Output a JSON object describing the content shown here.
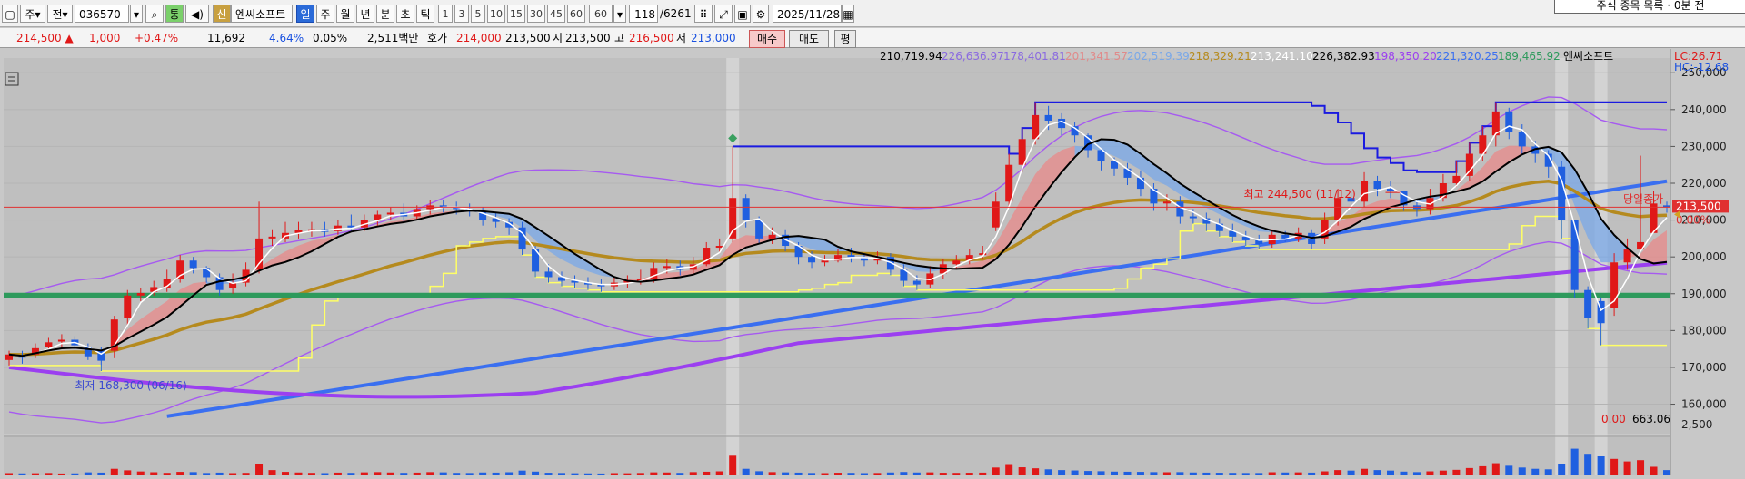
{
  "toolbar": {
    "period": "주",
    "period_alt": "전",
    "code": "036570",
    "name": "엔씨소프트",
    "badge_new": "신",
    "badge_tong": "통",
    "tf_day": "일",
    "tf_week": "주",
    "tf_month": "월",
    "tf_year": "년",
    "tf_minute": "분",
    "tf_tick_sec": "초",
    "tf_tick": "틱",
    "n1": "1",
    "n3": "3",
    "n5": "5",
    "n10": "10",
    "n15": "15",
    "n30": "30",
    "n45": "45",
    "n60": "60",
    "n60b": "60",
    "count": "118",
    "total": "/6261",
    "date": "2025/11/28",
    "top_right_text": "주식 종목 목록 · 0분 전"
  },
  "quote": {
    "price": "214,500",
    "change": "1,000",
    "change_pct": "+0.47%",
    "volume": "11,692",
    "turnover_pct": "4.64%",
    "ratio": "0.05%",
    "amount": "2,511백만",
    "ask_label": "호가",
    "ask": "214,000",
    "bid": "213,500",
    "open_label": "시",
    "open": "213,500",
    "high_label": "고",
    "high": "216,500",
    "low_label": "저",
    "low": "213,000",
    "buy": "매수",
    "sell": "매도",
    "avg": "평"
  },
  "colors": {
    "up": "#e01818",
    "down": "#1f5fe0",
    "ma5": "#ffffff",
    "ma20": "#000000",
    "ma60": "#b58a1e",
    "ma120": "#3a6ff0",
    "ma240": "#9b3ff0",
    "envelope": "#a65af0",
    "support": "#2e9a5c",
    "donchian": "#1a1ae0",
    "trail": "#ffff66",
    "current": "#e03030"
  },
  "chart_data": {
    "type": "candlestick",
    "legend": {
      "items": [
        {
          "value": "210,719.94",
          "color": "#000000"
        },
        {
          "value": "226,636.97",
          "color": "#8a6ae0"
        },
        {
          "value": "178,401.81",
          "color": "#8a6ae0"
        },
        {
          "value": "201,341.57",
          "color": "#e08a8a"
        },
        {
          "value": "202,519.39",
          "color": "#7aa8e8"
        },
        {
          "value": "218,329.21",
          "color": "#b58a1e"
        },
        {
          "value": "213,241.10",
          "color": "#ffffff"
        },
        {
          "value": "226,382.93",
          "color": "#000000"
        },
        {
          "value": "198,350.20",
          "color": "#9b3ff0"
        },
        {
          "value": "221,320.25",
          "color": "#3a6ff0"
        },
        {
          "value": "189,465.92",
          "color": "#2e9a5c"
        }
      ],
      "name": "엔씨소프트",
      "lc": "LC:26.71",
      "hc": "HC:-12.68"
    },
    "y_axis": {
      "min": 152000,
      "max": 254000,
      "ticks": [
        "250,000",
        "240,000",
        "230,000",
        "220,000",
        "210,000",
        "200,000",
        "190,000",
        "180,000",
        "170,000",
        "160,000"
      ],
      "tick_values": [
        250000,
        240000,
        230000,
        220000,
        210000,
        200000,
        190000,
        180000,
        170000,
        160000
      ]
    },
    "current_price": {
      "value": 213500,
      "label": "213,500",
      "pct": "0.00%",
      "caption": "당일종가"
    },
    "support_level": 189500,
    "annotations": {
      "high": {
        "label": "최고 244,500 (11/12)",
        "index": 106
      },
      "low": {
        "label": "최저 168,300 (06/16)",
        "index": 1
      }
    },
    "volume_panel": {
      "legend_value": "0.00",
      "legend_total": "663.06",
      "tick": "2,500",
      "max": 3000
    },
    "closes": [
      173500,
      172800,
      175200,
      176800,
      177500,
      176000,
      173000,
      171800,
      183000,
      189500,
      190200,
      191800,
      194000,
      199000,
      197000,
      194500,
      191000,
      193000,
      196500,
      205000,
      205500,
      206500,
      207200,
      207500,
      206800,
      208500,
      208000,
      210000,
      211500,
      212000,
      211000,
      213000,
      214000,
      213500,
      213000,
      212500,
      210000,
      209500,
      208000,
      202000,
      196000,
      194500,
      193500,
      193000,
      192500,
      192000,
      193000,
      193500,
      194000,
      197000,
      197500,
      196500,
      198000,
      202500,
      203000,
      216000,
      210000,
      205000,
      206000,
      203000,
      200000,
      198500,
      199000,
      200500,
      200000,
      199000,
      200000,
      196500,
      193500,
      192500,
      195500,
      198000,
      199000,
      200500,
      201000,
      215000,
      225000,
      232000,
      238500,
      237000,
      235000,
      233000,
      229000,
      226000,
      224000,
      221500,
      218500,
      214500,
      215000,
      211000,
      210500,
      209000,
      207000,
      205500,
      204500,
      203500,
      206000,
      205000,
      206500,
      203500,
      210000,
      216000,
      215000,
      220500,
      218500,
      218000,
      214000,
      213000,
      216000,
      220000,
      222000,
      228000,
      233000,
      239500,
      234000,
      230000,
      228000,
      224500,
      210000,
      191000,
      183500,
      182000,
      198500,
      202000,
      204000,
      214500,
      213500
    ],
    "opens": [
      172000,
      173000,
      173500,
      175500,
      177000,
      177500,
      175500,
      174500,
      174500,
      183500,
      189500,
      190500,
      191500,
      194000,
      199000,
      197000,
      194500,
      191500,
      193000,
      196500,
      205000,
      205000,
      206500,
      207000,
      207500,
      207000,
      208500,
      208000,
      210000,
      211500,
      212000,
      211000,
      213000,
      214000,
      213500,
      213000,
      212500,
      210500,
      209500,
      208000,
      202000,
      196000,
      194500,
      193500,
      193000,
      192500,
      192000,
      193000,
      193500,
      194000,
      197000,
      197500,
      196500,
      198000,
      202500,
      205000,
      216000,
      210000,
      205000,
      206000,
      203000,
      200000,
      198500,
      199000,
      200500,
      200000,
      199000,
      200000,
      196500,
      193500,
      192500,
      195500,
      198000,
      199000,
      200500,
      208000,
      215000,
      225000,
      232000,
      238500,
      237500,
      235500,
      233000,
      229000,
      226000,
      224000,
      221500,
      218500,
      214500,
      215000,
      211000,
      210500,
      209000,
      207000,
      205500,
      204500,
      203500,
      206000,
      205000,
      206500,
      205000,
      210000,
      216000,
      215000,
      220500,
      218500,
      218000,
      214000,
      213000,
      216000,
      220000,
      222000,
      228000,
      233000,
      239500,
      234000,
      230000,
      228000,
      224500,
      210000,
      191000,
      188000,
      186000,
      198500,
      202000,
      206500,
      214000
    ],
    "highs": [
      174500,
      174500,
      176500,
      178000,
      179000,
      178500,
      176500,
      175500,
      184000,
      191000,
      191500,
      193500,
      196500,
      200500,
      200000,
      197500,
      195500,
      195500,
      198500,
      215000,
      207500,
      209500,
      209500,
      209500,
      209500,
      210000,
      211500,
      211500,
      212500,
      213500,
      214500,
      214000,
      215500,
      215500,
      215000,
      214500,
      213500,
      212000,
      210500,
      209500,
      203000,
      198000,
      196000,
      195000,
      194500,
      194000,
      194500,
      195000,
      196500,
      198500,
      199500,
      199000,
      200000,
      204000,
      205000,
      230000,
      217000,
      211000,
      208000,
      207500,
      204000,
      201500,
      200500,
      202000,
      202500,
      201000,
      201500,
      201000,
      198000,
      195000,
      197500,
      199500,
      200500,
      202000,
      203000,
      217500,
      228000,
      235000,
      242000,
      241000,
      239000,
      236500,
      233500,
      229500,
      227000,
      225500,
      223500,
      220000,
      217000,
      216500,
      213000,
      212000,
      210500,
      209000,
      207000,
      206000,
      207500,
      207000,
      208000,
      207500,
      212000,
      218500,
      218000,
      223000,
      222000,
      220500,
      217500,
      215500,
      218500,
      222500,
      226000,
      231000,
      235500,
      242000,
      240500,
      236000,
      231500,
      229000,
      226000,
      210000,
      192000,
      189000,
      201000,
      205000,
      227500,
      218000,
      215000
    ],
    "lows": [
      170500,
      171000,
      172500,
      174500,
      175500,
      175000,
      172000,
      169000,
      172500,
      181500,
      188000,
      189500,
      190500,
      193000,
      195500,
      193000,
      189500,
      190000,
      192000,
      195500,
      203000,
      204000,
      205000,
      205500,
      205500,
      206000,
      207000,
      207000,
      208500,
      210000,
      209500,
      210000,
      211500,
      212000,
      211500,
      211000,
      208500,
      208000,
      206000,
      200500,
      194500,
      193000,
      192000,
      191500,
      191000,
      190500,
      191000,
      191500,
      192500,
      193000,
      195500,
      195000,
      195500,
      197500,
      201000,
      204000,
      208000,
      203500,
      203500,
      201500,
      198000,
      197000,
      197500,
      198500,
      198500,
      197500,
      198000,
      195000,
      192000,
      191000,
      191500,
      194000,
      197000,
      198000,
      199500,
      207000,
      213500,
      223000,
      230500,
      234500,
      233000,
      231000,
      227000,
      223500,
      222000,
      219500,
      216500,
      212500,
      212500,
      209000,
      209000,
      207000,
      205500,
      204000,
      203000,
      202000,
      202500,
      204000,
      204000,
      202000,
      203500,
      208500,
      213000,
      213500,
      216500,
      216000,
      212500,
      211000,
      211500,
      215000,
      219000,
      220500,
      226000,
      230000,
      232000,
      228000,
      225500,
      221500,
      205000,
      189000,
      180500,
      176000,
      184000,
      196500,
      201500,
      211500,
      212000
    ],
    "volumes": [
      180,
      160,
      170,
      190,
      150,
      160,
      240,
      220,
      520,
      400,
      310,
      250,
      200,
      280,
      260,
      190,
      220,
      180,
      200,
      900,
      420,
      280,
      230,
      200,
      180,
      220,
      200,
      240,
      260,
      230,
      200,
      220,
      260,
      240,
      200,
      190,
      230,
      220,
      250,
      380,
      300,
      210,
      190,
      170,
      160,
      150,
      180,
      170,
      190,
      240,
      230,
      200,
      260,
      290,
      320,
      1550,
      520,
      330,
      260,
      240,
      220,
      190,
      180,
      210,
      200,
      180,
      190,
      230,
      270,
      230,
      240,
      210,
      200,
      210,
      220,
      620,
      820,
      640,
      560,
      480,
      420,
      390,
      350,
      330,
      300,
      290,
      280,
      260,
      250,
      260,
      230,
      220,
      210,
      200,
      190,
      190,
      250,
      230,
      240,
      220,
      320,
      420,
      380,
      520,
      420,
      380,
      300,
      260,
      320,
      380,
      440,
      580,
      720,
      960,
      760,
      620,
      520,
      480,
      880,
      2100,
      1700,
      1500,
      1300,
      1100,
      1200,
      680,
      420
    ]
  }
}
